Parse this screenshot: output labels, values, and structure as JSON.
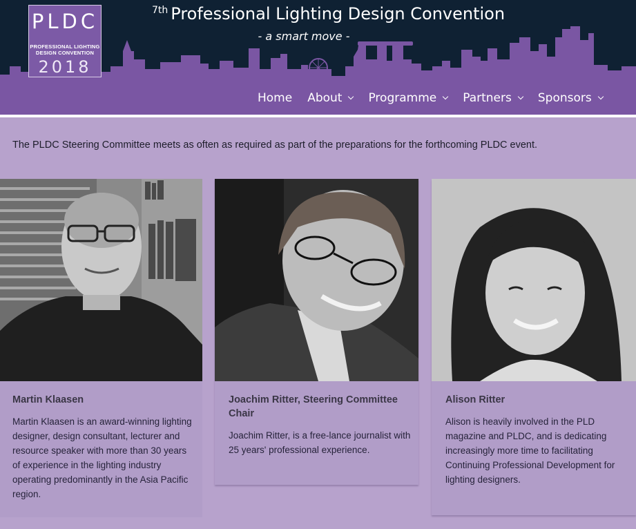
{
  "header": {
    "logo": {
      "letters": "PLDC",
      "line1": "PROFESSIONAL LIGHTING",
      "line2": "DESIGN CONVENTION",
      "year": "2018"
    },
    "title_ordinal": "7th",
    "title": "Professional Lighting Design Convention",
    "tagline": "- a smart move -"
  },
  "nav": [
    {
      "label": "Home",
      "has_dropdown": false
    },
    {
      "label": "About",
      "has_dropdown": true
    },
    {
      "label": "Programme",
      "has_dropdown": true
    },
    {
      "label": "Partners",
      "has_dropdown": true
    },
    {
      "label": "Sponsors",
      "has_dropdown": true
    }
  ],
  "intro": "The PLDC Steering Committee meets as often as required as part of the preparations for the forthcoming PLDC event.",
  "members": [
    {
      "name": "Martin Klaasen",
      "bio": "Martin Klaasen is an award-winning lighting designer, design consultant, lecturer and resource speaker with more than 30 years of experience in the lighting industry operating predominantly in the Asia Pacific region."
    },
    {
      "name": "Joachim Ritter, Steering Committee Chair",
      "bio": "Joachim Ritter, is a free-lance journalist with 25 years' professional experience."
    },
    {
      "name": "Alison Ritter",
      "bio": "Alison is heavily involved in the PLD magazine and PLDC, and is dedicating increasingly more time to facilitating Continuing Professional Development for lighting designers."
    }
  ],
  "colors": {
    "header_bg": "#0f2133",
    "skyline": "#7a56a3",
    "page_bg": "#b7a2cc",
    "card_bg": "#b19dc8",
    "logo_bg": "#7c5aa6"
  },
  "icons": [
    "chevron-down-icon"
  ]
}
